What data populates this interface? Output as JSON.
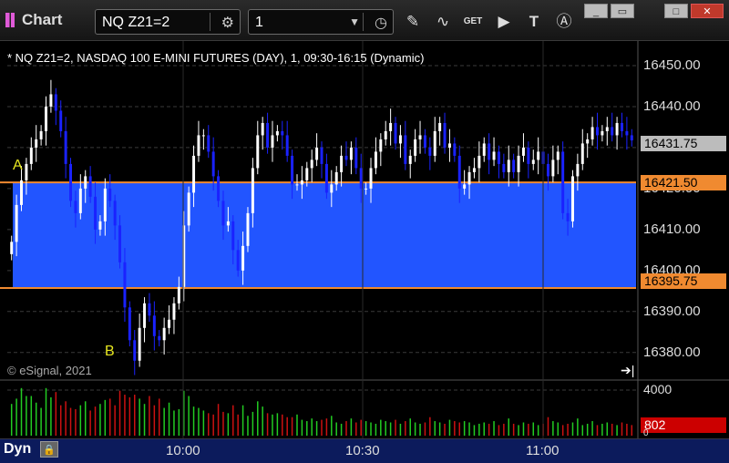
{
  "window": {
    "title": "Chart",
    "symbol_value": "NQ Z21=2",
    "interval_value": "1",
    "controls": {
      "minimize": "_",
      "restore": "▭",
      "maximize": "□",
      "close": "✕"
    }
  },
  "toolbar": {
    "icons": [
      "gear-icon",
      "clock-icon",
      "pencil-icon",
      "study-icon",
      "get-icon",
      "play-icon",
      "text-icon",
      "alert-icon"
    ],
    "get_label": "GET",
    "text_label": "T"
  },
  "chart": {
    "info_line": "* NQ Z21=2, NASDAQ 100 E-MINI FUTURES (DAY), 1, 09:30-16:15 (Dynamic)",
    "copyright": "© eSignal, 2021",
    "label_a": "A",
    "label_b": "B",
    "last_price_tag": "16431.75",
    "upper_line_tag": "16421.50",
    "lower_line_tag": "16395.75",
    "volume_last_tag": "802",
    "volume_axis_top": "4000",
    "volume_axis_zero": "0",
    "colors": {
      "up": "#ffffff",
      "down": "#1a22ff",
      "zone": "#2255ff",
      "zone_line": "#f08a30",
      "vol_up": "#22cc22",
      "vol_down": "#cc1111"
    }
  },
  "bottom": {
    "mode": "Dyn",
    "icon": "lock-icon"
  },
  "chart_data": {
    "type": "candlestick",
    "title": "NQ Z21=2, NASDAQ 100 E-MINI FUTURES (DAY), 1, 09:30-16:15 (Dynamic)",
    "y_ticks": [
      16450.0,
      16440.0,
      16430.0,
      16420.0,
      16410.0,
      16400.0,
      16390.0,
      16380.0
    ],
    "ylim": [
      16373.5,
      16456
    ],
    "x_ticks": [
      "10:00",
      "10:30",
      "11:00"
    ],
    "last_price": 16431.75,
    "zone": {
      "upper": 16421.5,
      "lower": 16395.75
    },
    "volume_ylim": [
      0,
      4000
    ],
    "volume_last": 802,
    "close_series": [
      16407,
      16416,
      16422,
      16426,
      16430,
      16432,
      16434,
      16440,
      16443,
      16439,
      16434,
      16426,
      16417,
      16414,
      16420,
      16423,
      16418,
      16410,
      16412,
      16420,
      16417,
      16411,
      16402,
      16391,
      16383,
      16378,
      16386,
      16392,
      16389,
      16384,
      16383,
      16386,
      16388,
      16392,
      16396,
      16411,
      16419,
      16428,
      16433,
      16433,
      16429,
      16423,
      16417,
      16411,
      16412,
      16405,
      16400,
      16406,
      16414,
      16425,
      16433,
      16436,
      16430,
      16433,
      16434,
      16433,
      16428,
      16421,
      16421,
      16422,
      16425,
      16427,
      16430,
      16426,
      16419,
      16421,
      16424,
      16428,
      16427,
      16430,
      16425,
      16420,
      16420,
      16425,
      16429,
      16432,
      16434,
      16436,
      16431,
      16433,
      16426,
      16428,
      16432,
      16433,
      16430,
      16428,
      16434,
      16436,
      16430,
      16431,
      16428,
      16420,
      16421,
      16424,
      16425,
      16428,
      16431,
      16427,
      16429,
      16426,
      16424,
      16427,
      16424,
      16428,
      16430,
      16426,
      16427,
      16429,
      16426,
      16423,
      16427,
      16429,
      16414,
      16412,
      16423,
      16426,
      16431,
      16432,
      16435,
      16433,
      16434,
      16435,
      16433,
      16436,
      16434,
      16433,
      16431.75
    ],
    "volume_series": [
      2400,
      2800,
      3600,
      3000,
      3000,
      2500,
      2100,
      3600,
      2900,
      3300,
      2300,
      2600,
      2100,
      2000,
      2300,
      2600,
      1900,
      2200,
      2400,
      2700,
      2800,
      2300,
      3400,
      3100,
      2900,
      3100,
      2800,
      2400,
      3000,
      2300,
      2800,
      2100,
      2500,
      1900,
      2000,
      3400,
      3000,
      2200,
      2100,
      1900,
      1700,
      1600,
      2400,
      1800,
      1700,
      2300,
      1600,
      2300,
      1500,
      1800,
      2600,
      2200,
      1700,
      1600,
      1700,
      1600,
      1400,
      1400,
      1600,
      1200,
      1100,
      1300,
      1100,
      1200,
      1300,
      1500,
      1000,
      900,
      1100,
      1300,
      1000,
      1200,
      1100,
      1000,
      900,
      1200,
      1100,
      1000,
      1200,
      900,
      1100,
      1300,
      1000,
      900,
      1000,
      1400,
      1100,
      1000,
      900,
      1200,
      1100,
      1000,
      1100,
      1000,
      800,
      900,
      1000,
      900,
      1100,
      800,
      900,
      1300,
      900,
      800,
      1000,
      900,
      1000,
      800,
      900,
      1400,
      1100,
      1000,
      800,
      900,
      1000,
      1300,
      800,
      900,
      1100,
      800,
      900,
      1000,
      900,
      800,
      1000,
      900,
      802
    ]
  }
}
